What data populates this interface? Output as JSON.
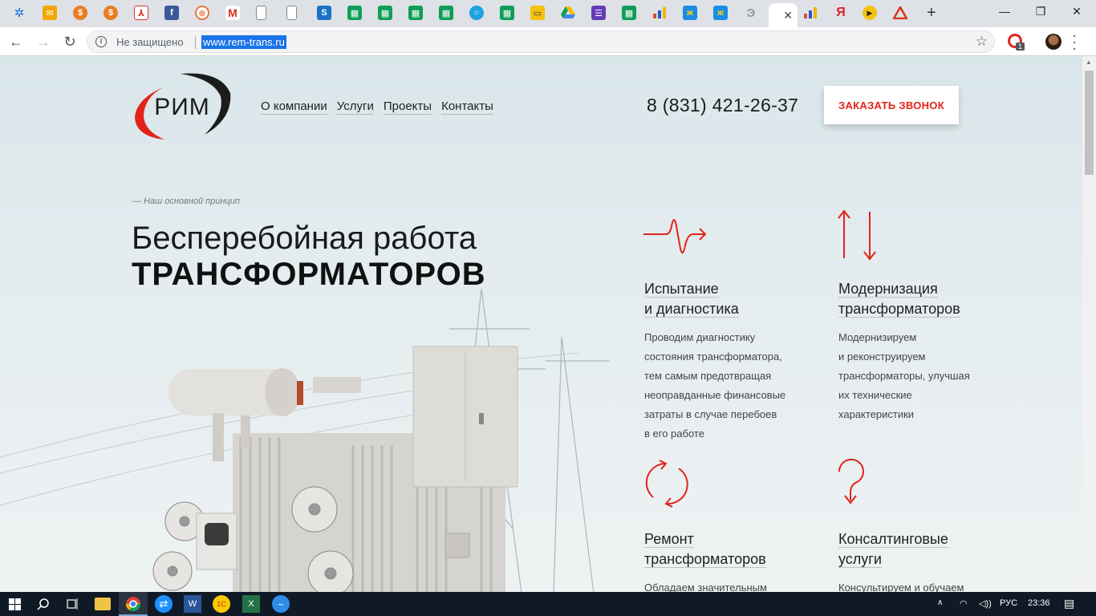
{
  "browser": {
    "url": "www.rem-trans.ru",
    "security_label": "Не защищено",
    "extension_badge": "1"
  },
  "site": {
    "logo_text": "РИМ",
    "nav": [
      "О компании",
      "Услуги",
      "Проекты",
      "Контакты"
    ],
    "phone": "8 (831) 421-26-37",
    "call_button": "ЗАКАЗАТЬ ЗВОНОК",
    "tagline": "— Наш основной принцип",
    "hero_line1": "Бесперебойная работа",
    "hero_line2": "ТРАНСФОРМАТОРОВ",
    "services": [
      {
        "icon": "pulse-icon",
        "title_l1": "Испытание",
        "title_l2": "и диагностика",
        "desc": [
          "Проводим диагностику",
          "состояния трансформатора,",
          "тем самым предотвращая",
          "неоправданные финансовые",
          "затраты в случае перебоев",
          "в его работе"
        ]
      },
      {
        "icon": "up-down-arrows-icon",
        "title_l1": "Модернизация",
        "title_l2": "трансформаторов",
        "desc": [
          "Модернизируем",
          "и реконструируем",
          "трансформаторы, улучшая",
          "их технические",
          "характеристики"
        ]
      },
      {
        "icon": "refresh-cycle-icon",
        "title_l1": "Ремонт",
        "title_l2": "трансформаторов",
        "desc": [
          "Обладаем значительным"
        ]
      },
      {
        "icon": "question-mark-icon",
        "title_l1": "Консалтинговые",
        "title_l2": "услуги",
        "desc": [
          "Консультируем и обучаем"
        ]
      }
    ]
  },
  "taskbar": {
    "language": "РУС",
    "time": "23:36"
  },
  "colors": {
    "brand_red": "#e2231a",
    "taskbar": "#101a26",
    "url_highlight": "#1a73e8"
  }
}
